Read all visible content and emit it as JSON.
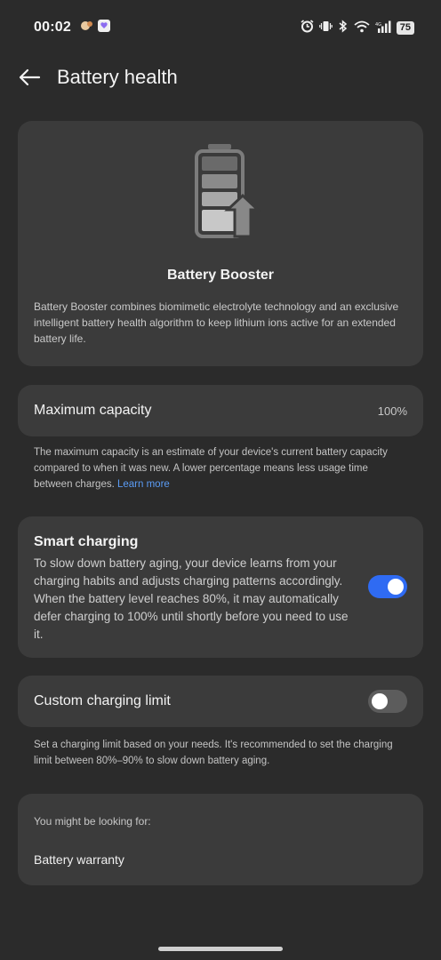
{
  "status_bar": {
    "time": "00:02",
    "battery_level": "75",
    "icons": [
      "alarm-icon",
      "vibrate-icon",
      "bluetooth-icon",
      "wifi-icon",
      "signal-icon"
    ]
  },
  "header": {
    "title": "Battery health"
  },
  "booster": {
    "title": "Battery Booster",
    "description": "Battery Booster combines biomimetic electrolyte technology and an exclusive intelligent battery health algorithm to keep lithium ions active for an extended battery life."
  },
  "max_capacity": {
    "label": "Maximum capacity",
    "value": "100%",
    "note": "The maximum capacity is an estimate of your device's current battery capacity compared to when it was new. A lower percentage means less usage time between charges.",
    "learn_more": "Learn more"
  },
  "smart_charging": {
    "title": "Smart charging",
    "description": "To slow down battery aging, your device learns from your charging habits and adjusts charging patterns accordingly. When the battery level reaches 80%, it may automatically defer charging to 100% until shortly before you need to use it.",
    "enabled": true
  },
  "custom_limit": {
    "label": "Custom charging limit",
    "enabled": false,
    "note": "Set a charging limit based on your needs. It's recommended to set the charging limit between 80%–90% to slow down battery aging."
  },
  "looking_for": {
    "label": "You might be looking for:",
    "link": "Battery warranty"
  },
  "colors": {
    "background": "#2b2b2b",
    "card": "#3b3b3b",
    "accent": "#2f6bf3",
    "link": "#5b9cf5"
  }
}
